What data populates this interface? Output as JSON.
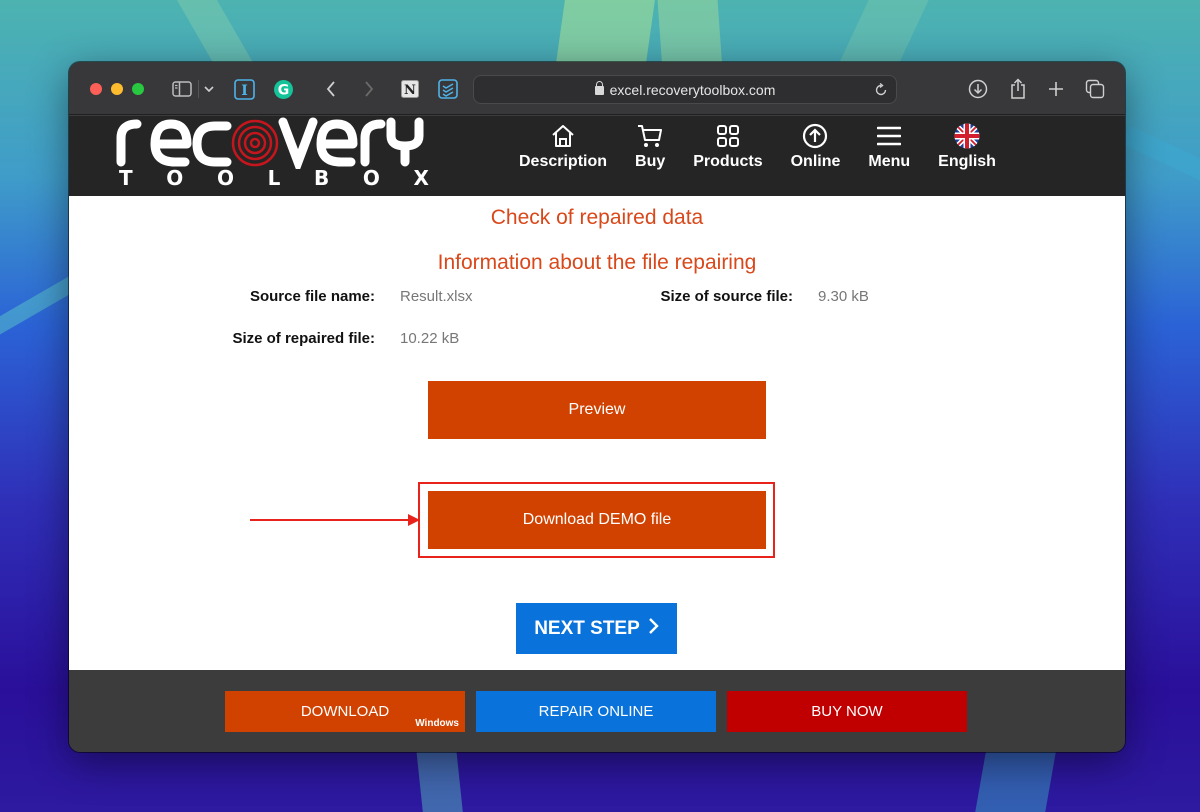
{
  "browser": {
    "url": "excel.recoverytoolbox.com",
    "icons": [
      "sidebar-icon",
      "chevron-down-icon",
      "instapaper-icon",
      "grammarly-icon",
      "back-icon",
      "forward-icon",
      "notion-icon",
      "todoist-icon",
      "reader-icon",
      "reload-icon",
      "download-icon",
      "share-icon",
      "new-tab-icon",
      "tabs-overview-icon"
    ]
  },
  "site": {
    "logo": {
      "word": "recovery",
      "sub_letters": [
        "T",
        "O",
        "O",
        "L",
        "B",
        "O",
        "X"
      ]
    },
    "nav": [
      {
        "label": "Description",
        "icon": "home-icon"
      },
      {
        "label": "Buy",
        "icon": "cart-icon"
      },
      {
        "label": "Products",
        "icon": "grid-icon"
      },
      {
        "label": "Online",
        "icon": "upload-circle-icon"
      },
      {
        "label": "Menu",
        "icon": "hamburger-icon"
      },
      {
        "label": "English",
        "icon": "uk-flag-icon"
      }
    ]
  },
  "main": {
    "title": "Check of repaired data",
    "subtitle": "Information about the file repairing",
    "info": {
      "source_name_label": "Source file name:",
      "source_name_value": "Result.xlsx",
      "source_size_label": "Size of source file:",
      "source_size_value": "9.30 kB",
      "repaired_size_label": "Size of repaired file:",
      "repaired_size_value": "10.22 kB"
    },
    "preview_label": "Preview",
    "download_demo_label": "Download DEMO file",
    "next_step_label": "NEXT STEP",
    "next_step_chevron": "›"
  },
  "footer": {
    "download_label": "DOWNLOAD",
    "download_sub": "Windows",
    "repair_online_label": "REPAIR ONLINE",
    "buy_now_label": "BUY NOW"
  },
  "colors": {
    "accent_orange": "#d14200",
    "title_orange": "#d9481a",
    "next_blue": "#0a73db",
    "buy_red": "#c00000",
    "annotation_red": "#e8231c"
  }
}
